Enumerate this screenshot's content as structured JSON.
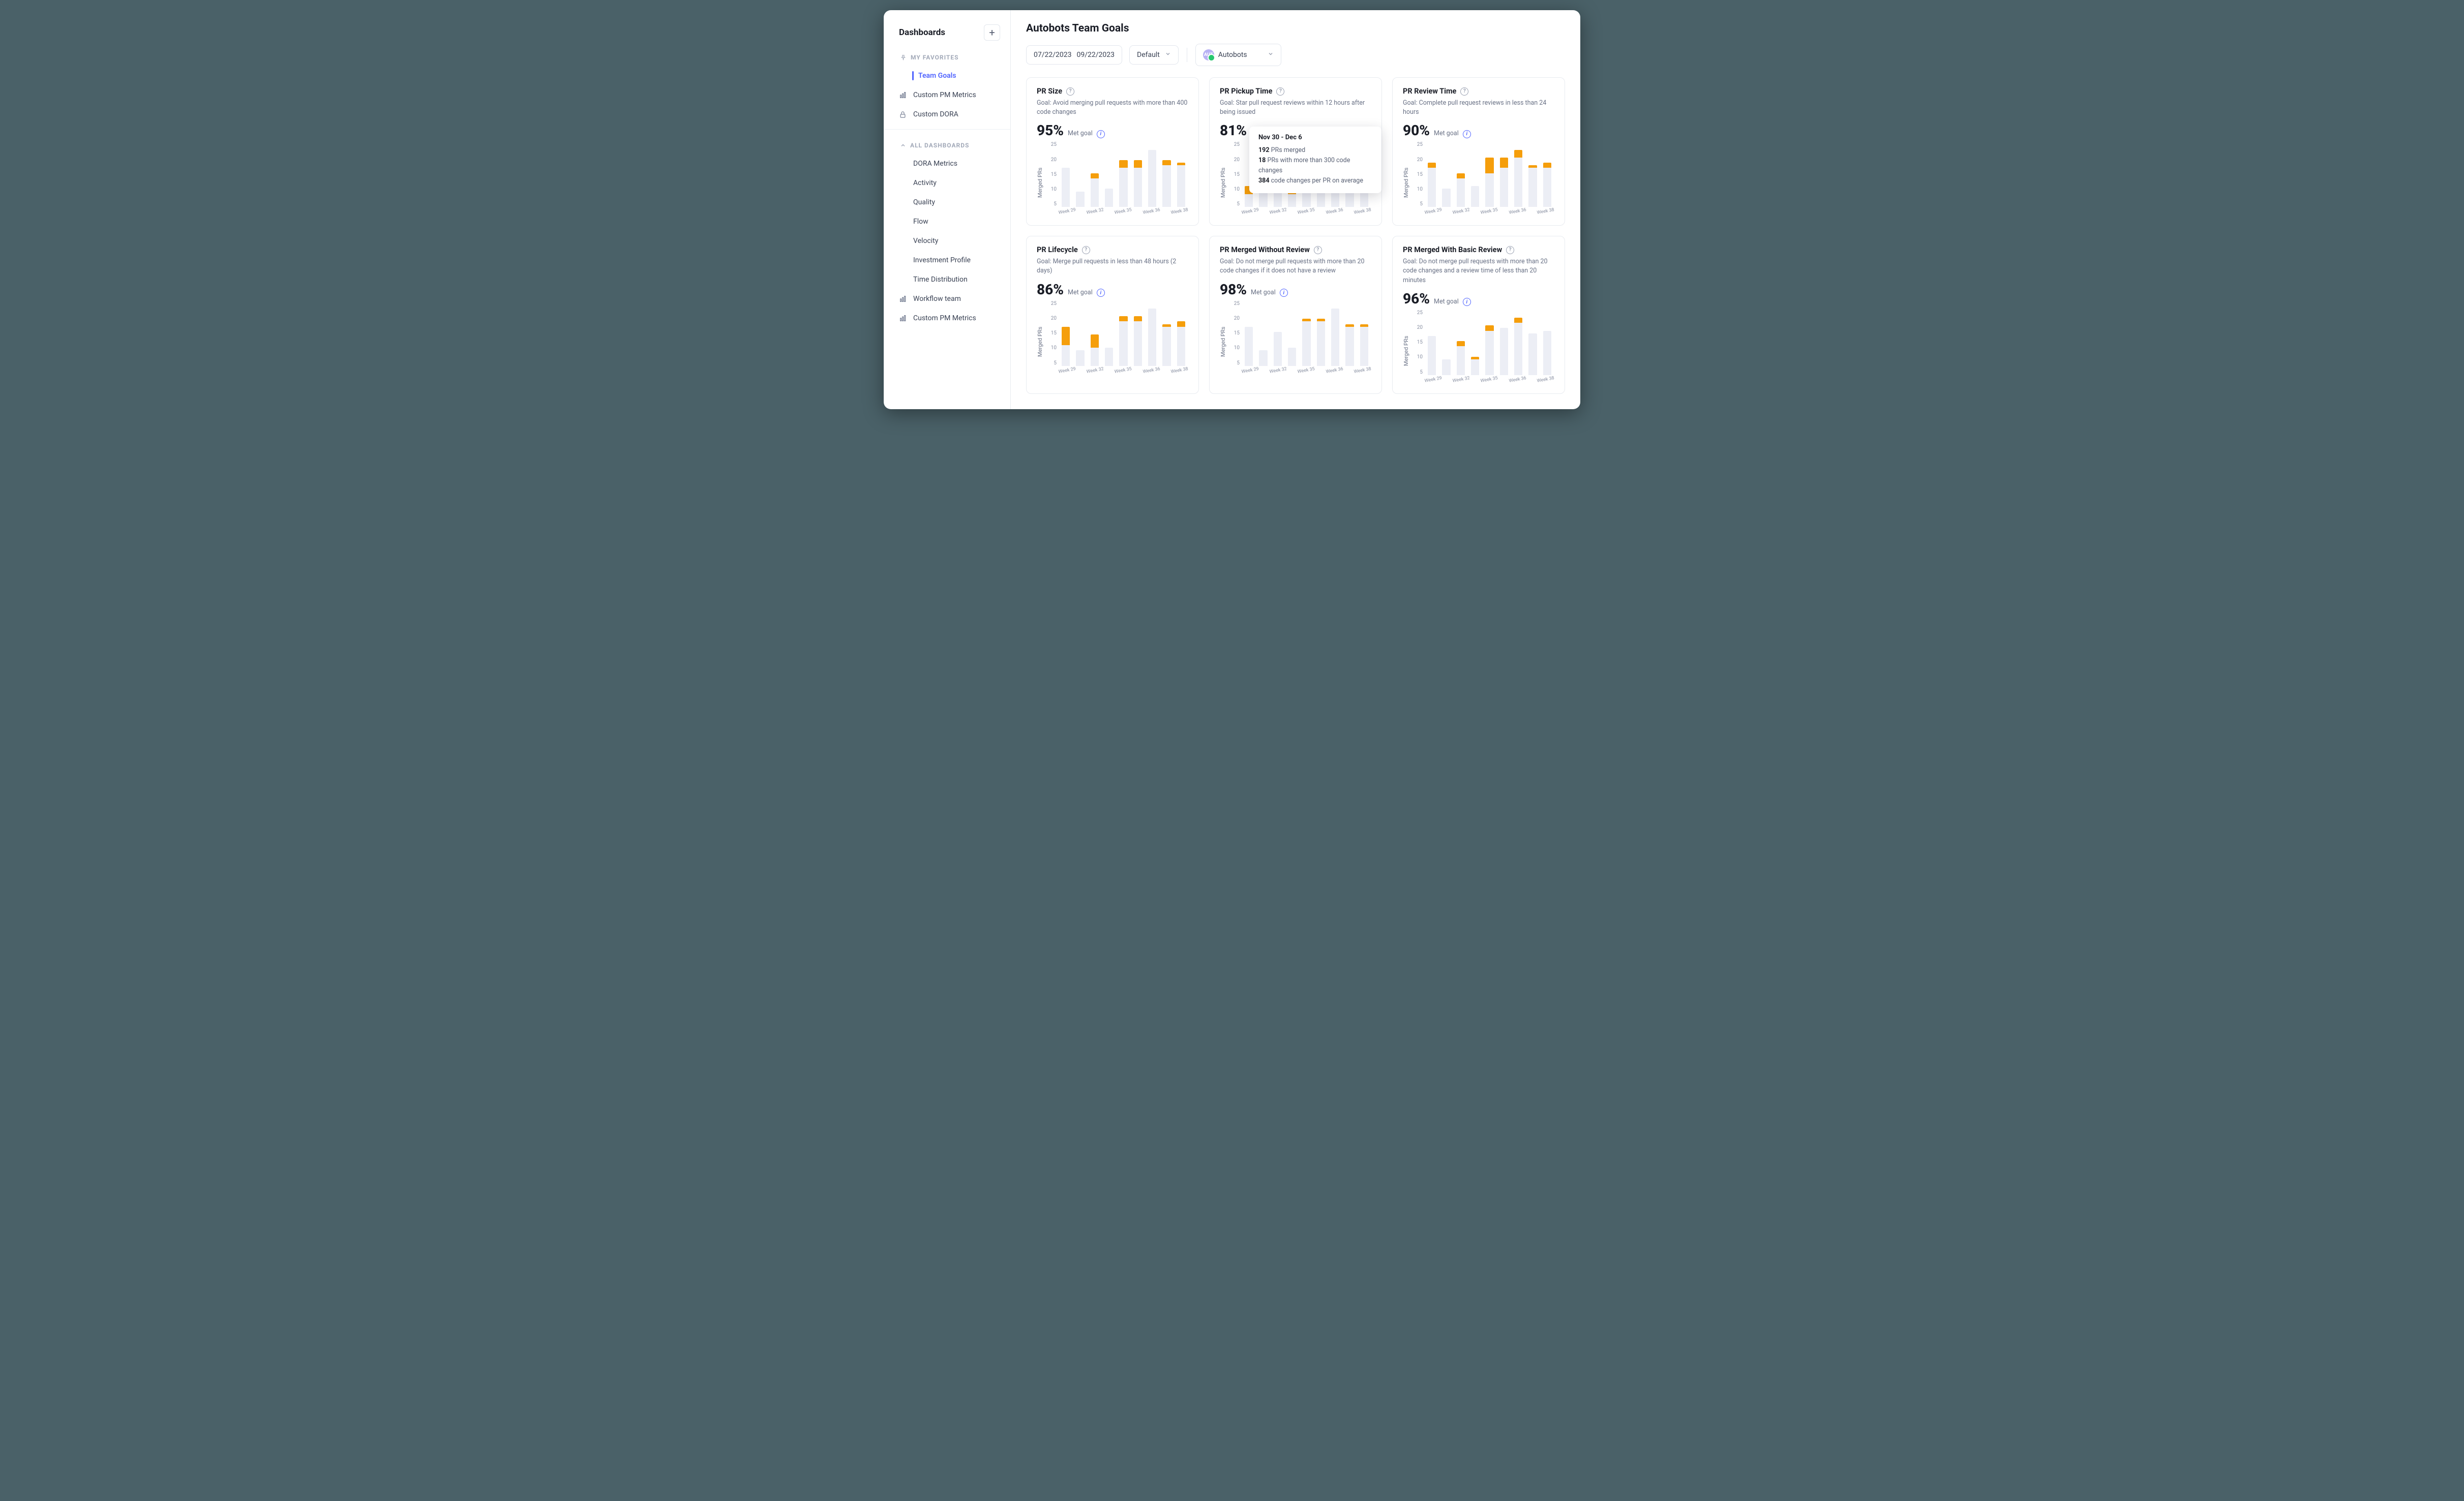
{
  "sidebar": {
    "title": "Dashboards",
    "favorites_label": "MY  FAVORITES",
    "all_label": "ALL DASHBOARDS",
    "fav_items": [
      {
        "label": "Team Goals",
        "icon": "",
        "active": true
      },
      {
        "label": "Custom PM Metrics",
        "icon": "bars"
      },
      {
        "label": "Custom DORA",
        "icon": "lock"
      }
    ],
    "all_items": [
      {
        "label": "DORA Metrics"
      },
      {
        "label": "Activity"
      },
      {
        "label": "Quality"
      },
      {
        "label": "Flow"
      },
      {
        "label": "Velocity"
      },
      {
        "label": "Investment Profile"
      },
      {
        "label": "Time Distribution"
      },
      {
        "label": "Workflow team",
        "icon": "bars"
      },
      {
        "label": "Custom PM Metrics",
        "icon": "bars"
      }
    ]
  },
  "header": {
    "title": "Autobots Team Goals",
    "date_from": "07/22/2023",
    "date_to": "09/22/2023",
    "preset": "Default",
    "team": "Autobots",
    "team_initials": "AUT"
  },
  "chart_common": {
    "ylabel": "Merged PRs",
    "yticks": [
      "25",
      "20",
      "15",
      "10",
      "5"
    ],
    "xticks": [
      "Week 29",
      "Week 32",
      "Week 35",
      "Week 36",
      "Week 38"
    ],
    "sub_label": "Met goal"
  },
  "chart_data": [
    {
      "type": "bar",
      "title": "PR Size",
      "goal": "Goal: Avoid merging pull requests with more than 400 code changes",
      "metric": "95%",
      "ylabel": "Merged PRs",
      "ylim": [
        0,
        25
      ],
      "data": [
        {
          "x": "Week 29",
          "total": 15,
          "over": 0
        },
        {
          "x": "",
          "total": 6,
          "over": 0
        },
        {
          "x": "Week 32",
          "total": 13,
          "over": 2
        },
        {
          "x": "",
          "total": 7,
          "over": 0
        },
        {
          "x": "Week 35",
          "total": 18,
          "over": 3
        },
        {
          "x": "",
          "total": 18,
          "over": 3
        },
        {
          "x": "Week 36",
          "total": 22,
          "over": 0
        },
        {
          "x": "",
          "total": 18,
          "over": 2
        },
        {
          "x": "Week 38",
          "total": 17,
          "over": 1
        }
      ]
    },
    {
      "type": "bar",
      "title": "PR Pickup Time",
      "goal": "Goal: Star pull request reviews within 12 hours after being issued",
      "metric": "81%",
      "ylabel": "Merged PRs",
      "ylim": [
        0,
        25
      ],
      "data": [
        {
          "x": "Week 29",
          "total": 8,
          "over": 3
        },
        {
          "x": "",
          "total": 7,
          "over": 1
        },
        {
          "x": "Week 32",
          "total": 7,
          "over": 1
        },
        {
          "x": "",
          "total": 8,
          "over": 3
        },
        {
          "x": "Week 35",
          "total": 18,
          "over": 0
        },
        {
          "x": "",
          "total": 18,
          "over": 0
        },
        {
          "x": "Week 36",
          "total": 22,
          "over": 0
        },
        {
          "x": "",
          "total": 18,
          "over": 0
        },
        {
          "x": "Week 38",
          "total": 17,
          "over": 0
        }
      ]
    },
    {
      "type": "bar",
      "title": "PR Review Time",
      "goal": "Goal: Complete pull request reviews in less than 24 hours",
      "metric": "90%",
      "ylabel": "Merged PRs",
      "ylim": [
        0,
        25
      ],
      "data": [
        {
          "x": "Week 29",
          "total": 17,
          "over": 2
        },
        {
          "x": "",
          "total": 7,
          "over": 0
        },
        {
          "x": "Week 32",
          "total": 13,
          "over": 2
        },
        {
          "x": "",
          "total": 8,
          "over": 0
        },
        {
          "x": "Week 35",
          "total": 19,
          "over": 6
        },
        {
          "x": "",
          "total": 19,
          "over": 4
        },
        {
          "x": "Week 36",
          "total": 22,
          "over": 3
        },
        {
          "x": "",
          "total": 16,
          "over": 1
        },
        {
          "x": "Week 38",
          "total": 17,
          "over": 2
        }
      ]
    },
    {
      "type": "bar",
      "title": "PR Lifecycle",
      "goal": "Goal: Merge pull requests in less than 48 hours (2 days)",
      "metric": "86%",
      "ylabel": "Merged PRs",
      "ylim": [
        0,
        25
      ],
      "data": [
        {
          "x": "Week 29",
          "total": 15,
          "over": 7
        },
        {
          "x": "",
          "total": 6,
          "over": 0
        },
        {
          "x": "Week 32",
          "total": 12,
          "over": 5
        },
        {
          "x": "",
          "total": 7,
          "over": 0
        },
        {
          "x": "Week 35",
          "total": 19,
          "over": 2
        },
        {
          "x": "",
          "total": 19,
          "over": 2
        },
        {
          "x": "Week 36",
          "total": 22,
          "over": 0
        },
        {
          "x": "",
          "total": 16,
          "over": 1
        },
        {
          "x": "Week 38",
          "total": 17,
          "over": 2
        }
      ]
    },
    {
      "type": "bar",
      "title": "PR Merged Without Review",
      "goal": "Goal: Do not merge pull requests with more than 20 code changes if it does not have a review",
      "metric": "98%",
      "ylabel": "Merged PRs",
      "ylim": [
        0,
        25
      ],
      "data": [
        {
          "x": "Week 29",
          "total": 15,
          "over": 0
        },
        {
          "x": "",
          "total": 6,
          "over": 0
        },
        {
          "x": "Week 32",
          "total": 13,
          "over": 0
        },
        {
          "x": "",
          "total": 7,
          "over": 0
        },
        {
          "x": "Week 35",
          "total": 18,
          "over": 1
        },
        {
          "x": "",
          "total": 18,
          "over": 1
        },
        {
          "x": "Week 36",
          "total": 22,
          "over": 0
        },
        {
          "x": "",
          "total": 16,
          "over": 1
        },
        {
          "x": "Week 38",
          "total": 16,
          "over": 1
        }
      ]
    },
    {
      "type": "bar",
      "title": "PR Merged With Basic Review",
      "goal": "Goal: Do not merge pull requests with more than 20 code changes and a review time of less than 20 minutes",
      "metric": "96%",
      "ylabel": "Merged PRs",
      "ylim": [
        0,
        25
      ],
      "data": [
        {
          "x": "Week 29",
          "total": 15,
          "over": 0
        },
        {
          "x": "",
          "total": 6,
          "over": 0
        },
        {
          "x": "Week 32",
          "total": 13,
          "over": 2
        },
        {
          "x": "",
          "total": 7,
          "over": 1
        },
        {
          "x": "Week 35",
          "total": 19,
          "over": 2
        },
        {
          "x": "",
          "total": 18,
          "over": 0
        },
        {
          "x": "Week 36",
          "total": 22,
          "over": 2
        },
        {
          "x": "",
          "total": 16,
          "over": 0
        },
        {
          "x": "Week 38",
          "total": 17,
          "over": 0
        }
      ]
    }
  ],
  "tooltip": {
    "title": "Nov 30 - Dec 6",
    "line1_n": "192",
    "line1_t": " PRs merged",
    "line2_n": "18",
    "line2_t": " PRs with more than 300 code changes",
    "line3_n": "384",
    "line3_t": " code changes per PR on average"
  }
}
